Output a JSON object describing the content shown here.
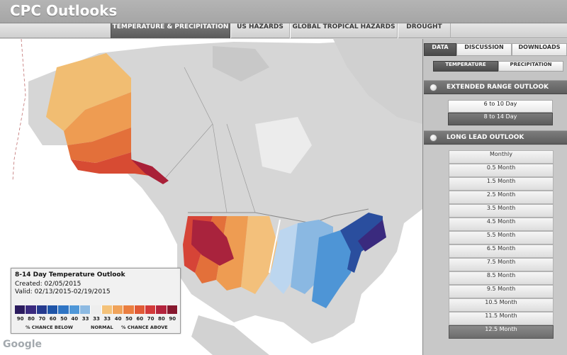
{
  "app": {
    "title": "CPC Outlooks"
  },
  "nav": {
    "tabs": [
      {
        "label": "TEMPERATURE & PRECIPITATION",
        "active": true
      },
      {
        "label": "US HAZARDS",
        "active": false
      },
      {
        "label": "GLOBAL TROPICAL HAZARDS",
        "active": false
      },
      {
        "label": "DROUGHT",
        "active": false
      }
    ]
  },
  "side": {
    "tabs": [
      "DATA",
      "DISCUSSION",
      "DOWNLOADS"
    ],
    "subtabs": [
      "TEMPERATURE",
      "PRECIPITATION"
    ],
    "extended": {
      "label": "EXTENDED RANGE OUTLOOK",
      "options": [
        "6 to 10 Day",
        "8 to 14 Day"
      ],
      "selected": "8 to 14 Day"
    },
    "longlead": {
      "label": "LONG LEAD OUTLOOK",
      "header": "Monthly",
      "options": [
        "0.5 Month",
        "1.5 Month",
        "2.5 Month",
        "3.5 Month",
        "4.5 Month",
        "5.5 Month",
        "6.5 Month",
        "7.5 Month",
        "8.5 Month",
        "9.5 Month",
        "10.5 Month",
        "11.5 Month",
        "12.5 Month"
      ],
      "selected": "12.5 Month"
    }
  },
  "legend": {
    "title": "8-14 Day Temperature Outlook",
    "created": "Created: 02/05/2015",
    "valid": "Valid: 02/13/2015-02/19/2015",
    "ticks": [
      "90",
      "80",
      "70",
      "60",
      "50",
      "40",
      "33",
      "33",
      "33",
      "40",
      "50",
      "60",
      "70",
      "80",
      "90"
    ],
    "captions": {
      "below": "% CHANCE BELOW",
      "normal": "NORMAL",
      "above": "% CHANCE ABOVE"
    },
    "colors": [
      "#2b1b5e",
      "#3a2a7e",
      "#253a8e",
      "#1f55a8",
      "#2f75c4",
      "#4f97d8",
      "#8dbae2",
      "#eeeeee",
      "#f4c27a",
      "#f0a35a",
      "#ea7e40",
      "#e05a36",
      "#d23a3a",
      "#b3243d",
      "#86182e"
    ]
  },
  "map": {
    "brand": "Google"
  }
}
